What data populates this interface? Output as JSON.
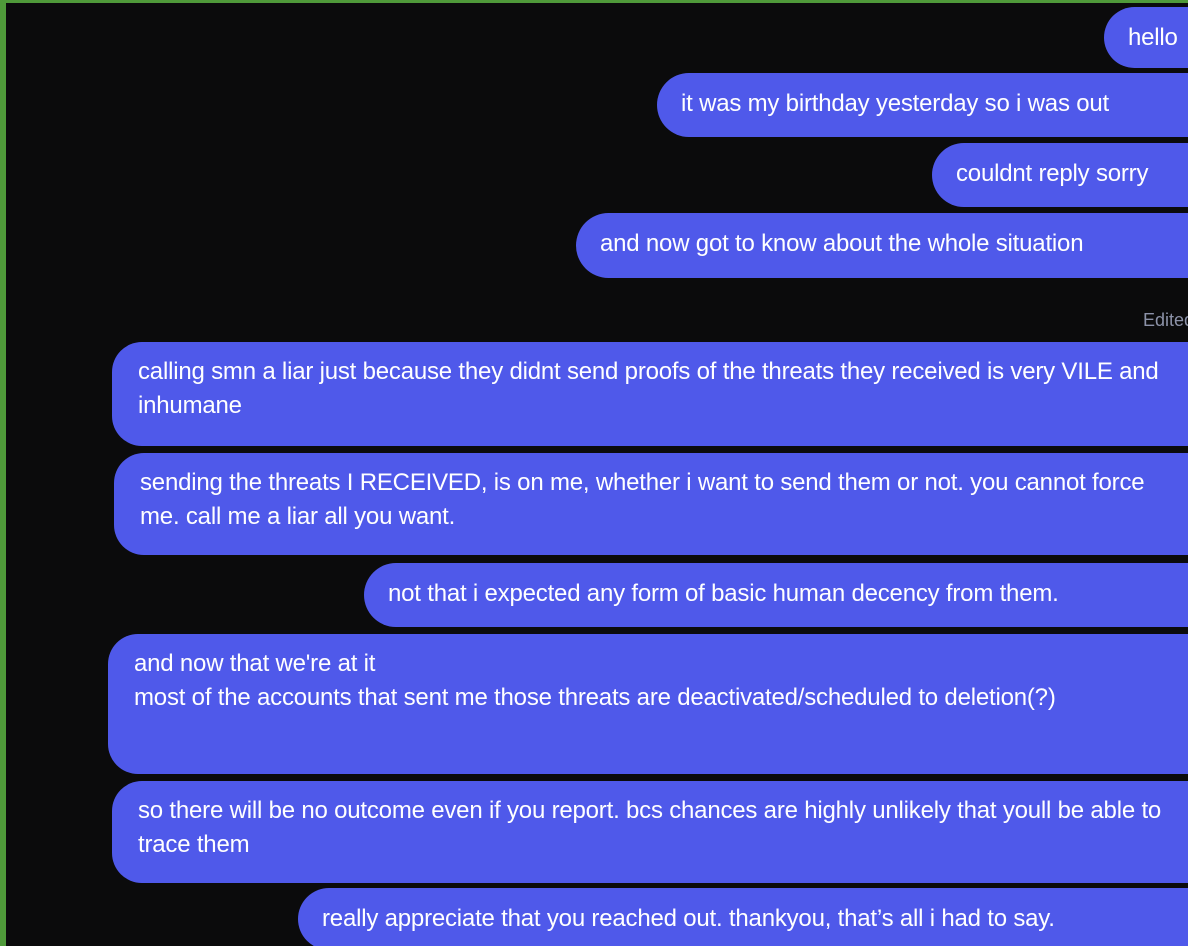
{
  "colors": {
    "outer_border": "#4f9a3a",
    "background": "#0b0b0c",
    "bubble": "#4f59ea",
    "bubble_text": "#ffffff",
    "edited_text": "#8c92a8"
  },
  "messages": [
    {
      "text": "hello"
    },
    {
      "text": "it was my birthday yesterday so i was out"
    },
    {
      "text": "couldnt reply sorry"
    },
    {
      "text": "and now got to know about the whole situation"
    },
    {
      "text": "calling smn a liar just because they didnt send proofs of the threats they received is very VILE and inhumane"
    },
    {
      "text": "sending the threats I RECEIVED, is on me, whether i want to send them or not. you cannot force me. call me a liar all you want."
    },
    {
      "text": "not that i expected any form of basic human decency from them."
    },
    {
      "text": "and now that we're at it\nmost of the accounts that sent me those threats are deactivated/scheduled to deletion(?)"
    },
    {
      "text": "so there will be no outcome even if you report. bcs chances are highly unlikely that youll be able to trace them"
    },
    {
      "text": "really appreciate that you reached out. thankyou, that’s all i had to say."
    }
  ],
  "edited_label": "Edited"
}
